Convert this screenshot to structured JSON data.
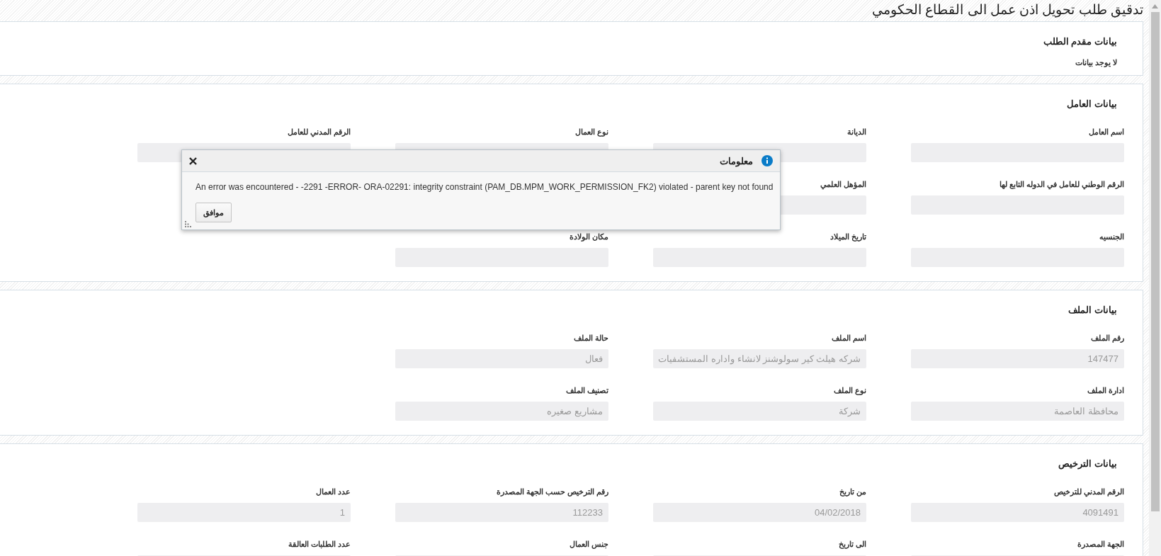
{
  "title": "تدقيق طلب تحويل اذن عمل الى القطاع الحكومي",
  "applicant": {
    "heading": "بيانات مقدم الطلب",
    "empty_text": "لا يوجد بيانات"
  },
  "sections": [
    {
      "heading": "بيانات العامل",
      "rows": [
        [
          {
            "kind": "field",
            "label": "اسم العامل"
          },
          {
            "kind": "field",
            "label": "الديانة"
          },
          {
            "kind": "field",
            "label": "نوع العمال"
          },
          {
            "kind": "field",
            "label": "الرقم المدني للعامل"
          }
        ],
        [
          {
            "kind": "field",
            "label": "الرقم الوطني للعامل في الدوله التابع لها"
          },
          {
            "kind": "field",
            "label": "المؤهل العلمي"
          },
          {
            "kind": "covered"
          },
          {
            "kind": "covered"
          }
        ],
        [
          {
            "kind": "field",
            "label": "الجنسيه"
          },
          {
            "kind": "field",
            "label": "تاريخ الميلاد"
          },
          {
            "kind": "field",
            "label": "مكان الولادة"
          }
        ]
      ]
    },
    {
      "heading": "بيانات الملف",
      "rows": [
        [
          {
            "kind": "field",
            "label": "رقم الملف",
            "value": "147477"
          },
          {
            "kind": "field",
            "label": "اسم الملف",
            "value": "شركه هيلث كير سولوشنز لانشاء واداره المستشفيات"
          },
          {
            "kind": "field",
            "label": "حالة الملف",
            "value": "فعال"
          }
        ],
        [
          {
            "kind": "field",
            "label": "ادارة الملف",
            "value": "محافظة العاصمة"
          },
          {
            "kind": "field",
            "label": "نوع الملف",
            "value": "شركة"
          },
          {
            "kind": "field",
            "label": "تصنيف الملف",
            "value": "مشاريع صغيره"
          }
        ]
      ]
    },
    {
      "heading": "بيانات الترخيص",
      "rows": [
        [
          {
            "kind": "field",
            "label": "الرقم المدني للترخيص",
            "value": "4091491"
          },
          {
            "kind": "field",
            "label": "من تاريخ",
            "value": "04/02/2018"
          },
          {
            "kind": "field",
            "label": "رقم الترخيص حسب الجهة المصدرة",
            "value": "112233"
          },
          {
            "kind": "field",
            "label": "عدد العمال",
            "value": "1"
          }
        ],
        [
          {
            "kind": "field",
            "label": "الجهة المصدرة"
          },
          {
            "kind": "field",
            "label": "الى تاريخ"
          },
          {
            "kind": "field",
            "label": "جنس العمال"
          },
          {
            "kind": "field",
            "label": "عدد الطلبات العالقة"
          }
        ]
      ]
    }
  ],
  "dialog": {
    "title": "معلومات",
    "message": "An error was encountered - -2291 -ERROR- ORA-02291: integrity constraint (PAM_DB.MPM_WORK_PERMISSION_FK2) violated - parent key not found",
    "buttons": [
      "موافق"
    ]
  }
}
